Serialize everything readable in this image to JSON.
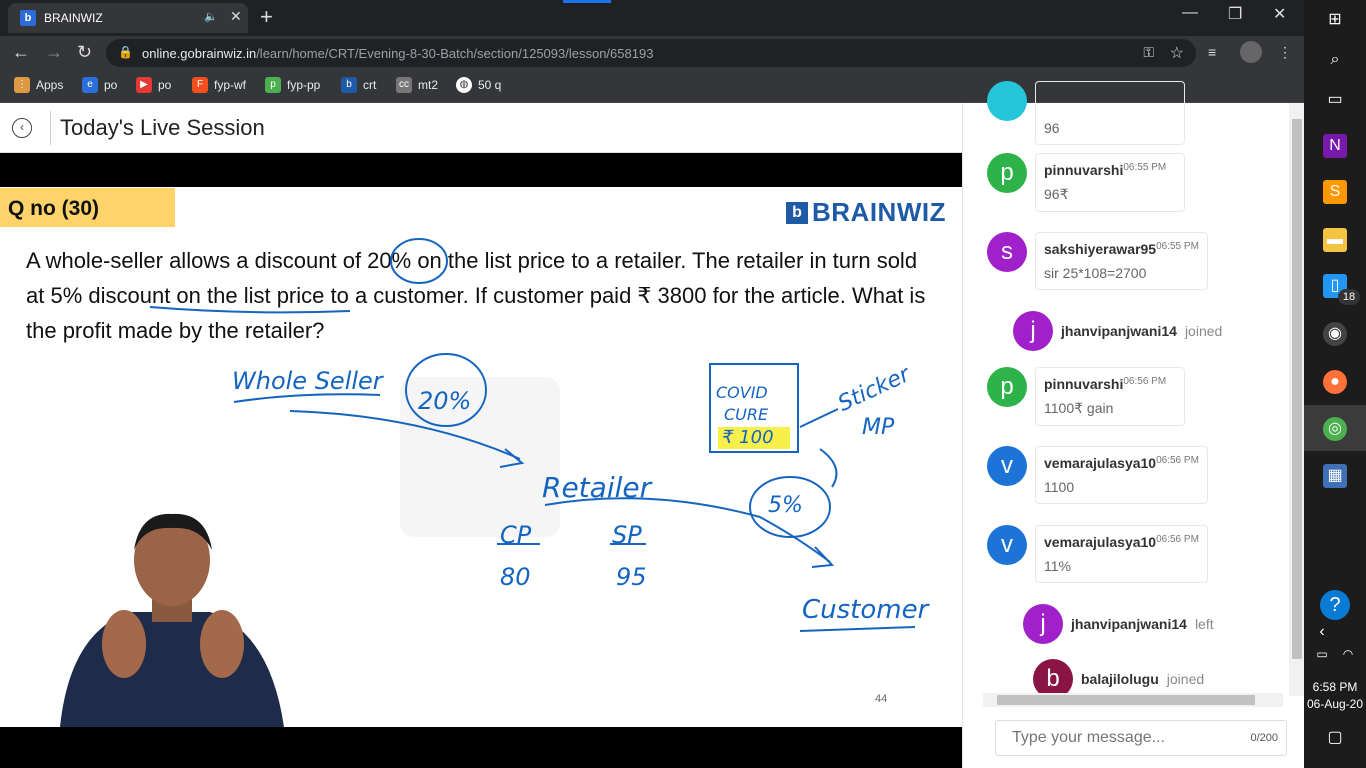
{
  "browser": {
    "tab_title": "BRAINWIZ",
    "url_domain": "online.gobrainwiz.in",
    "url_path": "/learn/home/CRT/Evening-8-30-Batch/section/125093/lesson/658193",
    "bookmarks": [
      "Apps",
      "po",
      "po",
      "fyp-wf",
      "fyp-pp",
      "crt",
      "mt2",
      "50 q"
    ]
  },
  "session": {
    "title": "Today's Live Session"
  },
  "slide": {
    "qno": "Q no (30)",
    "brand": "BRAINWIZ",
    "question": "A whole-seller allows a discount of 20% on the list price to a retailer. The retailer in turn sold at 5% discount on the list price to a customer. If customer paid ₹ 3800 for the article. What is the profit made by the retailer?",
    "annotations": {
      "whole_seller": "Whole Seller",
      "pct20": "20%",
      "covid1": "COVID",
      "covid2": "CURE",
      "price": "₹ 100",
      "sticker": "Sticker",
      "mp": "MP",
      "retailer": "Retailer",
      "pct5": "5%",
      "cp": "CP",
      "sp": "SP",
      "cp_val": "80",
      "sp_val": "95",
      "customer": "Customer"
    },
    "slide_number": "44"
  },
  "chat": {
    "messages": [
      {
        "user": "",
        "time": "",
        "text": "96",
        "initial": "",
        "color": "#26c6da"
      },
      {
        "user": "pinnuvarshi",
        "time": "06:55 PM",
        "text": "96₹",
        "initial": "p",
        "color": "#2db34a"
      },
      {
        "user": "sakshiyerawar95",
        "time": "06:55 PM",
        "text": "sir 25*108=2700",
        "initial": "s",
        "color": "#a021c9"
      },
      {
        "user": "pinnuvarshi",
        "time": "06:56 PM",
        "text": "1100₹ gain",
        "initial": "p",
        "color": "#2db34a"
      },
      {
        "user": "vemarajulasya10",
        "time": "06:56 PM",
        "text": "1100",
        "initial": "v",
        "color": "#1e74d6"
      },
      {
        "user": "vemarajulasya10",
        "time": "06:56 PM",
        "text": "11%",
        "initial": "v",
        "color": "#1e74d6"
      }
    ],
    "events": [
      {
        "user": "jhanvipanjwani14",
        "status": "joined",
        "initial": "j",
        "color": "#a021c9"
      },
      {
        "user": "jhanvipanjwani14",
        "status": "left",
        "initial": "j",
        "color": "#a021c9"
      },
      {
        "user": "balajilolugu",
        "status": "joined",
        "initial": "b",
        "color": "#8a1544"
      }
    ],
    "input_placeholder": "Type your message...",
    "char_count": "0/200"
  },
  "taskbar": {
    "badge": "18",
    "time": "6:58 PM",
    "date": "06-Aug-20"
  }
}
